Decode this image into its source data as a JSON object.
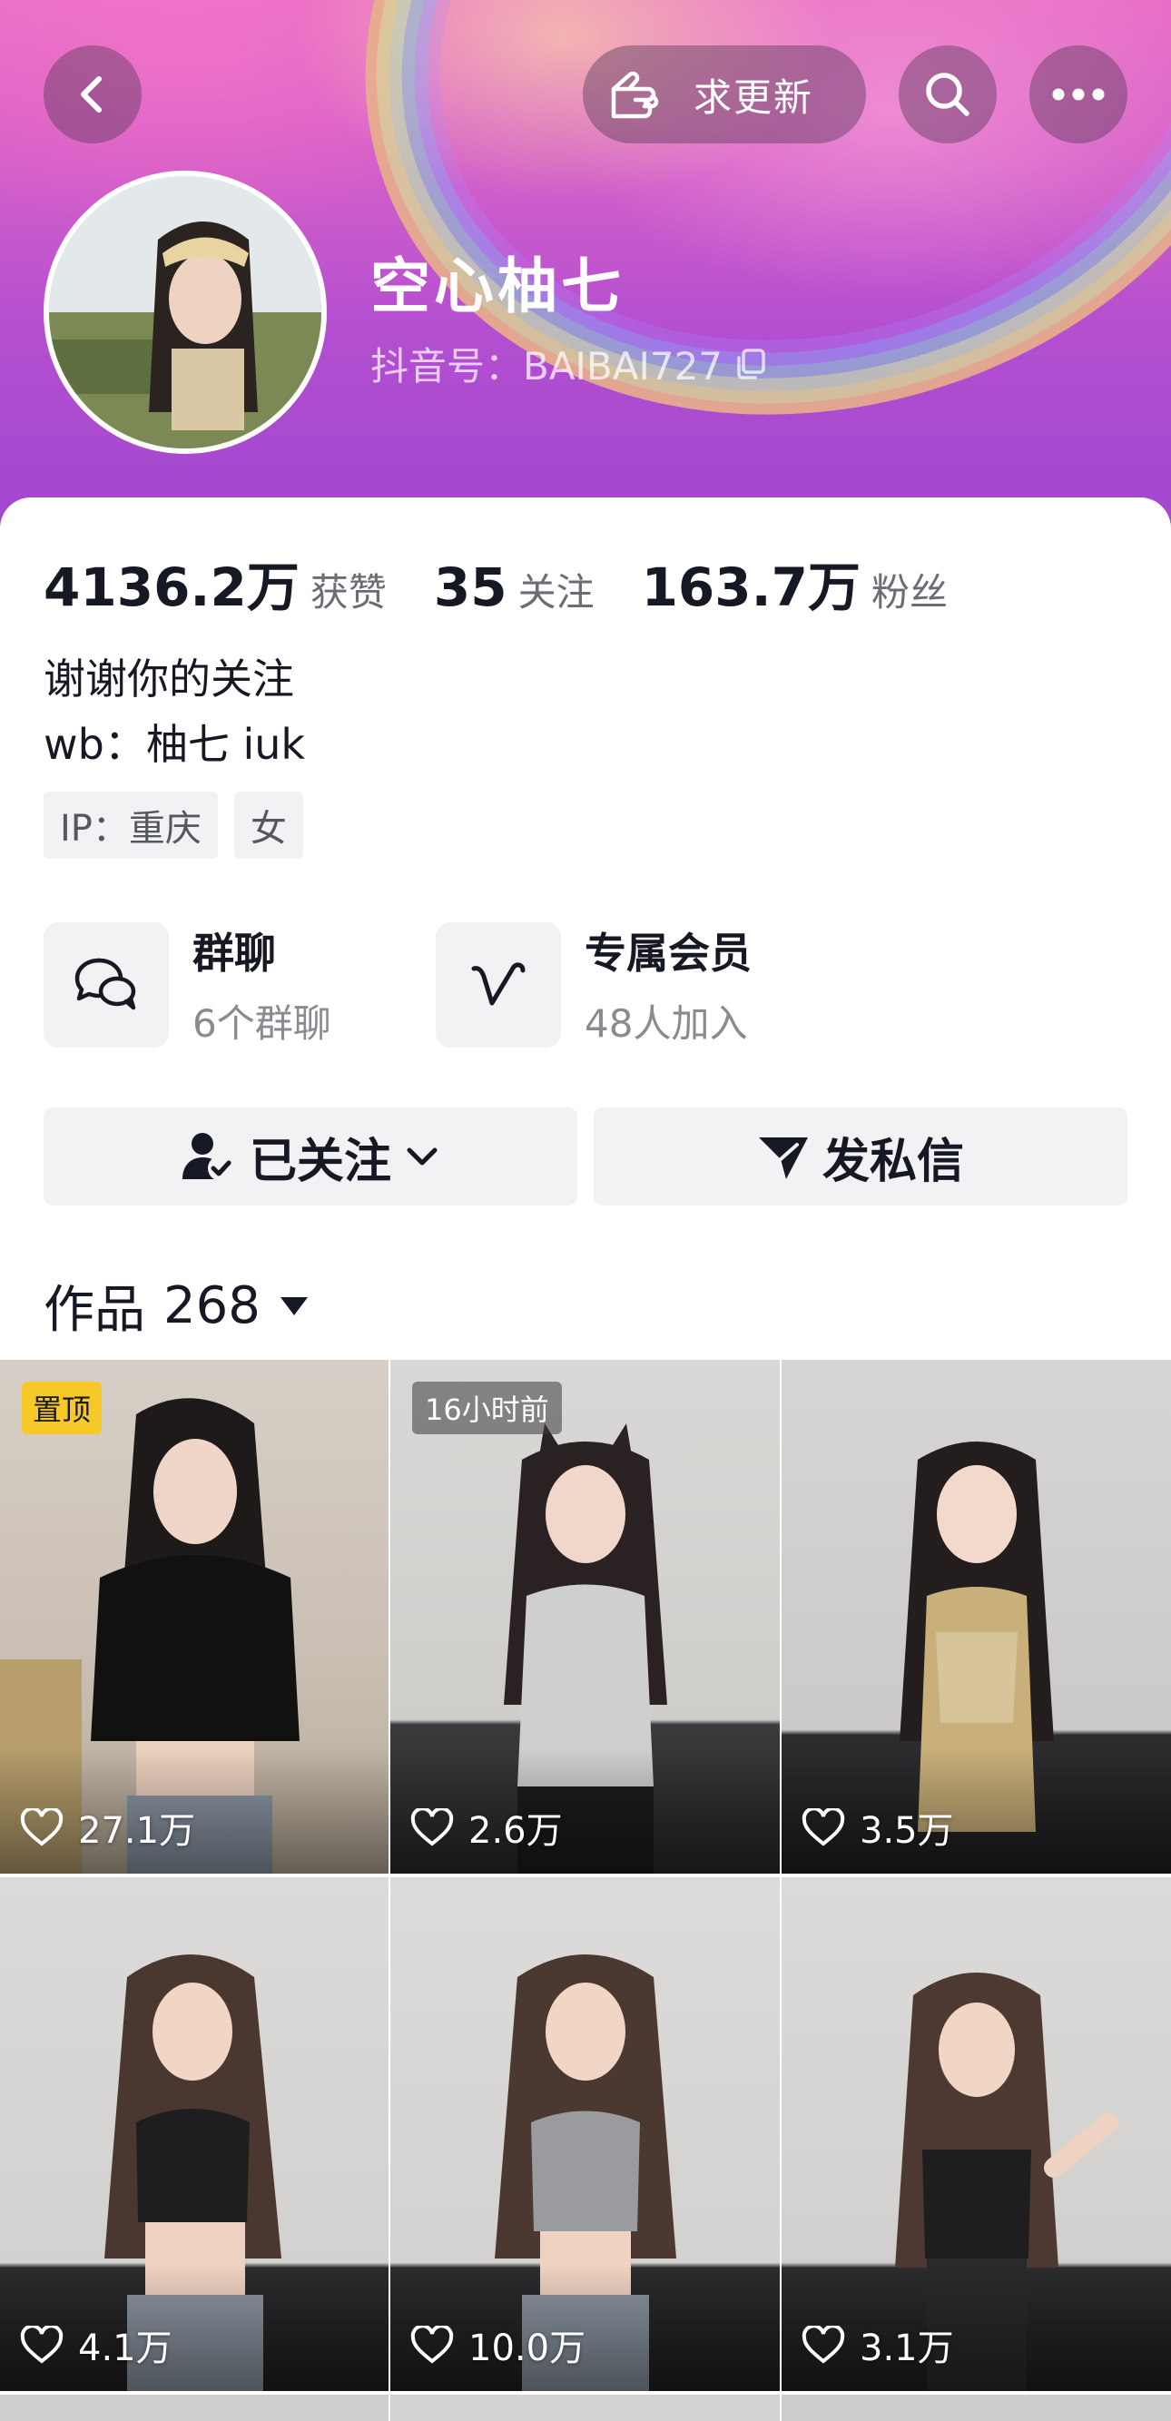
{
  "header": {
    "request_update_label": "求更新",
    "username": "空心柚七",
    "douyin_id": "抖音号：BAIBAI727"
  },
  "stats": [
    {
      "value": "4136.2万",
      "label": "获赞"
    },
    {
      "value": "35",
      "label": "关注"
    },
    {
      "value": "163.7万",
      "label": "粉丝"
    }
  ],
  "bio": {
    "line1": "谢谢你的关注",
    "line2": "wb：柚七 iuk"
  },
  "tags": [
    "IP：重庆",
    "女"
  ],
  "features": [
    {
      "title": "群聊",
      "subtitle": "6个群聊",
      "icon": "group-chat-icon"
    },
    {
      "title": "专属会员",
      "subtitle": "48人加入",
      "icon": "member-v-icon"
    }
  ],
  "actions": {
    "follow_label": "已关注",
    "message_label": "发私信"
  },
  "works": {
    "label": "作品",
    "count": "268"
  },
  "videos": [
    {
      "likes": "27.1万",
      "badge": "置顶",
      "badge_type": "pinned"
    },
    {
      "likes": "2.6万",
      "badge": "16小时前",
      "badge_type": "time"
    },
    {
      "likes": "3.5万",
      "badge": "",
      "badge_type": ""
    },
    {
      "likes": "4.1万",
      "badge": "",
      "badge_type": ""
    },
    {
      "likes": "10.0万",
      "badge": "",
      "badge_type": ""
    },
    {
      "likes": "3.1万",
      "badge": "",
      "badge_type": ""
    }
  ],
  "colors": {
    "banner_top": "#e86fc6",
    "banner_bottom": "#a046cf",
    "pinned_badge": "#f6c928",
    "button_bg": "#f2f2f4"
  }
}
